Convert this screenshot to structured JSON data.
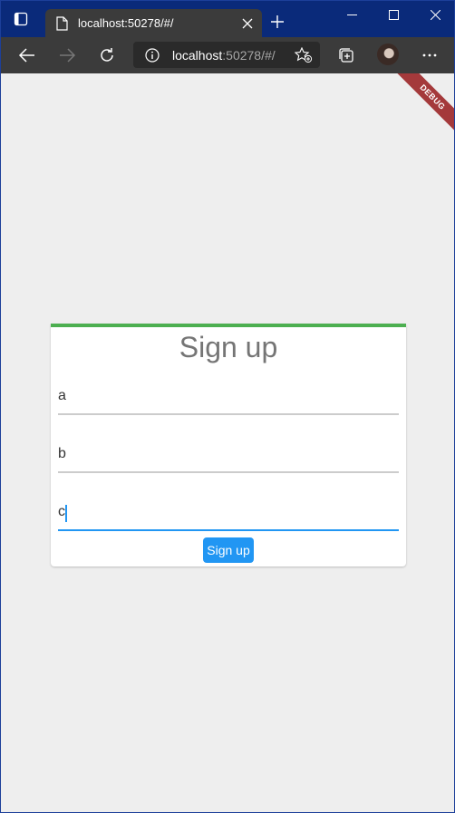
{
  "browser": {
    "tab_title": "localhost:50278/#/",
    "url_host": "localhost",
    "url_rest": ":50278/#/",
    "icons": {
      "tab_actions": "tab-actions-icon",
      "favicon": "page-icon",
      "tab_close": "close-icon",
      "new_tab": "plus-icon",
      "minimize": "minimize-icon",
      "maximize": "maximize-icon",
      "close_window": "close-window-icon",
      "back": "back-arrow-icon",
      "forward": "forward-arrow-icon",
      "refresh": "refresh-icon",
      "site_info": "info-icon",
      "favorites": "add-favorite-icon",
      "collections": "collections-icon",
      "more": "more-icon"
    }
  },
  "app": {
    "debug_banner": "DEBUG",
    "title": "Sign up",
    "fields": [
      {
        "value": "a"
      },
      {
        "value": "b"
      },
      {
        "value": "c"
      }
    ],
    "submit_label": "Sign up",
    "colors": {
      "accent_green": "#4caf50",
      "primary_blue": "#2196f3",
      "background": "#eeeeee"
    }
  }
}
